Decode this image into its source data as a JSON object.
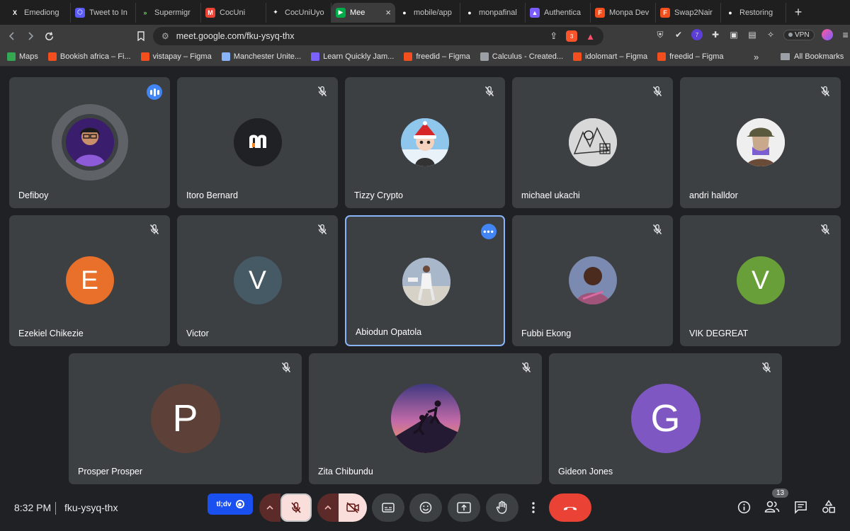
{
  "browser": {
    "tabs": [
      {
        "title": "Emediong",
        "icon": "x-logo-icon",
        "color": "#000000",
        "glyph": "X"
      },
      {
        "title": "Tweet to In",
        "icon": "hexagon-icon",
        "color": "#5b5bf7",
        "glyph": "⬡"
      },
      {
        "title": "Supermigr",
        "icon": "double-chevron-icon",
        "color": "#1f1f1f",
        "glyph": "»"
      },
      {
        "title": "CocUni",
        "icon": "gmail-icon",
        "color": "#ea4335",
        "glyph": "M"
      },
      {
        "title": "CocUniUyo",
        "icon": "spark-icon",
        "color": "#ffffff",
        "glyph": "✦"
      },
      {
        "title": "Mee",
        "icon": "meet-icon",
        "color": "#00ac47",
        "glyph": "▶",
        "active": true
      },
      {
        "title": "mobile/app",
        "icon": "github-icon",
        "color": "#ffffff",
        "glyph": "●"
      },
      {
        "title": "monpafinal",
        "icon": "github-icon",
        "color": "#ffffff",
        "glyph": "●"
      },
      {
        "title": "Authentica",
        "icon": "triangle-icon",
        "color": "#7a5cff",
        "glyph": "▲"
      },
      {
        "title": "Monpa Dev",
        "icon": "figma-icon",
        "color": "#f24e1e",
        "glyph": "F"
      },
      {
        "title": "Swap2Nair",
        "icon": "figma-icon",
        "color": "#f24e1e",
        "glyph": "F"
      },
      {
        "title": "Restoring",
        "icon": "github-icon",
        "color": "#ffffff",
        "glyph": "●"
      }
    ],
    "url": "meet.google.com/fku-ysyq-thx",
    "vpn_label": "VPN",
    "ext_badge": "7",
    "brave_badge": "3",
    "bookmarks": [
      {
        "label": "Maps",
        "color": "#34a853"
      },
      {
        "label": "Bookish africa – Fi...",
        "color": "#f24e1e"
      },
      {
        "label": "vistapay – Figma",
        "color": "#f24e1e"
      },
      {
        "label": "Manchester Unite...",
        "color": "#8ab4f8"
      },
      {
        "label": "Learn Quickly Jam...",
        "color": "#7b61ff"
      },
      {
        "label": "freedid – Figma",
        "color": "#f24e1e"
      },
      {
        "label": "Calculus - Created...",
        "color": "#9aa0a6"
      },
      {
        "label": "idolomart – Figma",
        "color": "#f24e1e"
      },
      {
        "label": "freedid – Figma",
        "color": "#f24e1e"
      }
    ],
    "bookmarks_more": "»",
    "all_bookmarks": "All Bookmarks"
  },
  "participants": [
    {
      "name": "Defiboy",
      "avatar": "image",
      "bg": "#3b1d6e"
    },
    {
      "name": "Itoro Bernard",
      "avatar": "image",
      "bg": "#202124"
    },
    {
      "name": "Tizzy Crypto",
      "avatar": "image",
      "bg": "#8fc6ec"
    },
    {
      "name": "michael ukachi",
      "avatar": "image",
      "bg": "#d8d8d8"
    },
    {
      "name": "andri halldor",
      "avatar": "image",
      "bg": "#efefef"
    },
    {
      "name": "Ezekiel Chikezie",
      "avatar": "letter",
      "letter": "E",
      "bg": "#e8702a"
    },
    {
      "name": "Victor",
      "avatar": "letter",
      "letter": "V",
      "bg": "#455a64"
    },
    {
      "name": "Abiodun Opatola",
      "avatar": "image",
      "bg": "#a8b7c9"
    },
    {
      "name": "Fubbi Ekong",
      "avatar": "image",
      "bg": "#5b3a2a"
    },
    {
      "name": "VIK DEGREAT",
      "avatar": "letter",
      "letter": "V",
      "bg": "#689f38"
    },
    {
      "name": "Prosper Prosper",
      "avatar": "letter",
      "letter": "P",
      "bg": "#5d4037"
    },
    {
      "name": "Zita Chibundu",
      "avatar": "image",
      "bg": "#6a4fa0"
    },
    {
      "name": "Gideon Jones",
      "avatar": "letter",
      "letter": "G",
      "bg": "#7e57c2"
    }
  ],
  "controls": {
    "time": "8:32 PM",
    "meeting_code": "fku-ysyq-thx",
    "tldv_label": "tl;dv",
    "people_count": "13"
  }
}
